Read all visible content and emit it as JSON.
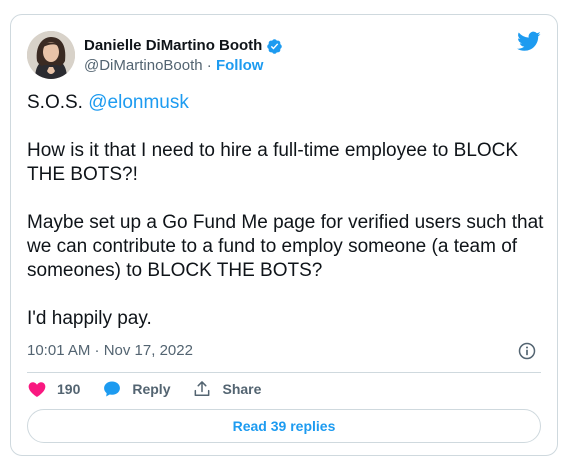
{
  "author": {
    "display_name": "Danielle DiMartino Booth",
    "handle": "@DiMartinoBooth",
    "separator": "·",
    "follow_label": "Follow"
  },
  "tweet": {
    "line1_prefix": "S.O.S. ",
    "line1_mention": "@elonmusk",
    "para2": "How is it that I need to hire a full-time employee to BLOCK THE BOTS?!",
    "para3": "Maybe set up a Go Fund Me page for verified users such that we can contribute to a fund to employ someone (a team of someones) to BLOCK THE BOTS?",
    "para4": "I'd happily pay."
  },
  "meta": {
    "timestamp": "10:01 AM · Nov 17, 2022"
  },
  "actions": {
    "likes_count": "190",
    "reply_label": "Reply",
    "share_label": "Share"
  },
  "footer": {
    "read_replies_label": "Read 39 replies"
  },
  "colors": {
    "accent": "#1d9bf0",
    "like": "#f91880",
    "text": "#0f1419",
    "muted": "#536471",
    "border": "#cfd9de"
  },
  "icons": {
    "verified": "verified-badge-icon",
    "brand": "twitter-bird-icon",
    "info": "info-icon",
    "like": "heart-icon",
    "reply": "speech-bubble-icon",
    "share": "share-arrow-icon"
  }
}
